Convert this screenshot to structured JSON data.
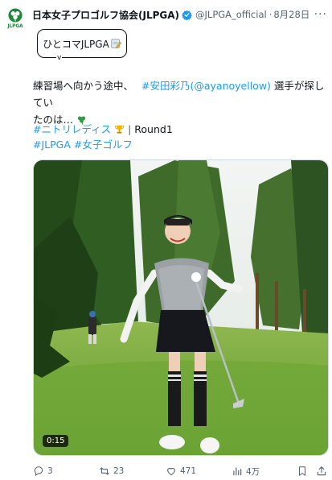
{
  "account": {
    "avatar_text": "JLPGA",
    "display_name": "日本女子プロゴルフ協会(JLPGA)",
    "handle": "@JLPGA_official",
    "separator": "·",
    "date": "8月28日",
    "more": "···"
  },
  "badge": {
    "label": "ひとコマJLPGA",
    "chevron": "v"
  },
  "tweet": {
    "line1_prefix": "練習場へ向かう途中、",
    "mention_name": "#安田彩乃",
    "mention_handle": "(@ayanoyellow)",
    "line1_suffix": "選手が探してい",
    "line2": "たのは…"
  },
  "hashtags": {
    "tag1": "#ニトリレディス",
    "separator": "|",
    "round": "Round1",
    "tag2": "#JLPGA",
    "tag3": "#女子ゴルフ"
  },
  "media": {
    "duration": "0:15"
  },
  "actions": {
    "replies": "3",
    "reposts": "23",
    "likes": "471",
    "views": "4万"
  },
  "colors": {
    "link": "#1d9bf0",
    "secondary_text": "#536471",
    "verified": "#1d9bf0",
    "brand_green": "#1f8a3c"
  }
}
